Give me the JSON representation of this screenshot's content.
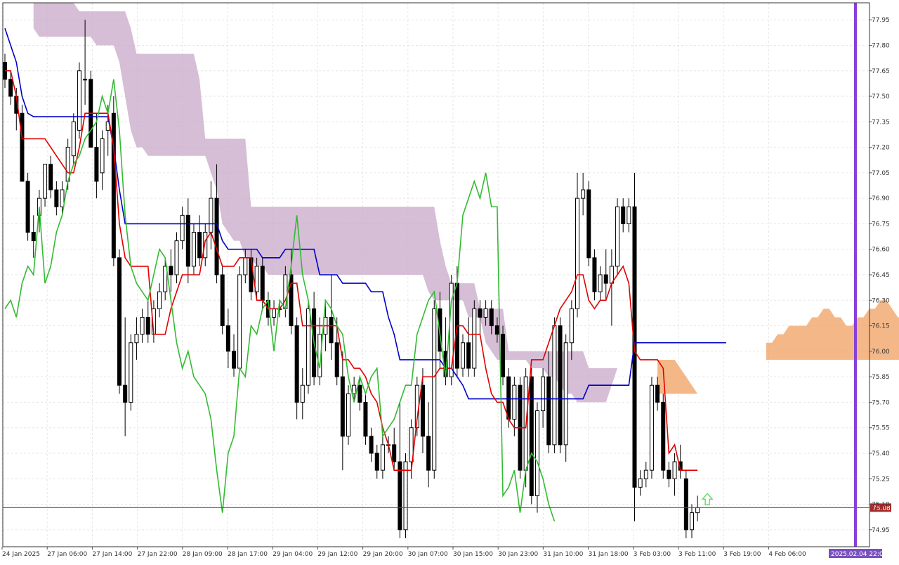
{
  "chart_data": {
    "type": "candlestick",
    "indicator": "Ichimoku Kinko Hyo",
    "ylim": [
      74.85,
      78.05
    ],
    "y_ticks": [
      "77.95",
      "77.80",
      "77.65",
      "77.50",
      "77.35",
      "77.20",
      "77.05",
      "76.90",
      "76.75",
      "76.60",
      "76.45",
      "76.30",
      "76.15",
      "76.00",
      "75.85",
      "75.70",
      "75.55",
      "75.40",
      "75.25",
      "75.10",
      "74.95"
    ],
    "x_ticks": [
      "24 Jan 2025",
      "27 Jan 06:00",
      "27 Jan 14:00",
      "27 Jan 22:00",
      "28 Jan 09:00",
      "28 Jan 17:00",
      "29 Jan 04:00",
      "29 Jan 12:00",
      "29 Jan 20:00",
      "30 Jan 07:00",
      "30 Jan 15:00",
      "30 Jan 23:00",
      "31 Jan 10:00",
      "31 Jan 18:00",
      "3 Feb 03:00",
      "3 Feb 11:00",
      "3 Feb 19:00",
      "4 Feb 06:00"
    ],
    "current_price": "75.08",
    "current_time_label": "2025.02.04 22:00",
    "candles": [
      [
        77.7,
        77.75,
        77.55,
        77.6
      ],
      [
        77.6,
        77.65,
        77.45,
        77.5
      ],
      [
        77.5,
        77.55,
        77.3,
        77.4
      ],
      [
        77.4,
        77.45,
        77.0,
        77.0
      ],
      [
        77.0,
        77.05,
        76.65,
        76.7
      ],
      [
        76.7,
        76.8,
        76.55,
        76.65
      ],
      [
        76.8,
        76.95,
        76.7,
        76.9
      ],
      [
        76.9,
        77.1,
        76.85,
        77.1
      ],
      [
        77.1,
        77.15,
        76.9,
        76.95
      ],
      [
        76.95,
        77.0,
        76.8,
        76.85
      ],
      [
        76.85,
        77.0,
        76.8,
        76.95
      ],
      [
        77.0,
        77.25,
        76.95,
        77.2
      ],
      [
        77.15,
        77.4,
        77.1,
        77.35
      ],
      [
        77.3,
        77.7,
        77.25,
        77.65
      ],
      [
        77.6,
        77.95,
        77.45,
        77.6
      ],
      [
        77.6,
        77.65,
        77.2,
        77.2
      ],
      [
        77.2,
        77.4,
        76.9,
        77.0
      ],
      [
        77.05,
        77.3,
        76.95,
        77.25
      ],
      [
        77.3,
        77.45,
        77.15,
        77.35
      ],
      [
        77.4,
        77.5,
        76.5,
        76.55
      ],
      [
        76.55,
        76.6,
        75.75,
        75.8
      ],
      [
        75.8,
        76.2,
        75.5,
        75.7
      ],
      [
        75.7,
        76.1,
        75.65,
        76.05
      ],
      [
        76.05,
        76.2,
        75.95,
        76.1
      ],
      [
        76.1,
        76.25,
        76.05,
        76.2
      ],
      [
        76.2,
        76.3,
        76.05,
        76.1
      ],
      [
        76.1,
        76.3,
        76.05,
        76.25
      ],
      [
        76.25,
        76.4,
        76.2,
        76.35
      ],
      [
        76.35,
        76.55,
        76.3,
        76.5
      ],
      [
        76.5,
        76.6,
        76.35,
        76.45
      ],
      [
        76.45,
        76.7,
        76.4,
        76.65
      ],
      [
        76.65,
        76.85,
        76.6,
        76.8
      ],
      [
        76.8,
        76.9,
        76.4,
        76.5
      ],
      [
        76.5,
        76.75,
        76.45,
        76.7
      ],
      [
        76.7,
        76.8,
        76.5,
        76.55
      ],
      [
        76.55,
        76.75,
        76.5,
        76.7
      ],
      [
        76.7,
        77.0,
        76.6,
        76.9
      ],
      [
        76.9,
        77.1,
        76.4,
        76.45
      ],
      [
        76.45,
        76.5,
        76.1,
        76.15
      ],
      [
        76.15,
        76.25,
        75.9,
        76.0
      ],
      [
        76.0,
        76.1,
        75.85,
        75.9
      ],
      [
        75.9,
        76.5,
        75.9,
        76.45
      ],
      [
        76.45,
        76.6,
        76.4,
        76.55
      ],
      [
        76.55,
        76.6,
        76.3,
        76.35
      ],
      [
        76.35,
        76.55,
        76.3,
        76.5
      ],
      [
        76.5,
        76.55,
        76.25,
        76.3
      ],
      [
        76.3,
        76.35,
        76.15,
        76.2
      ],
      [
        76.2,
        76.3,
        76.15,
        76.25
      ],
      [
        76.25,
        76.3,
        76.2,
        76.25
      ],
      [
        76.25,
        76.5,
        76.2,
        76.45
      ],
      [
        76.45,
        76.6,
        76.1,
        76.15
      ],
      [
        76.15,
        76.2,
        75.6,
        75.7
      ],
      [
        75.7,
        75.9,
        75.6,
        75.8
      ],
      [
        75.8,
        76.3,
        75.75,
        76.25
      ],
      [
        76.25,
        76.35,
        75.8,
        75.85
      ],
      [
        75.85,
        76.2,
        75.8,
        76.1
      ],
      [
        76.1,
        76.3,
        76.0,
        76.2
      ],
      [
        76.2,
        76.45,
        75.95,
        76.05
      ],
      [
        76.05,
        76.2,
        75.8,
        75.85
      ],
      [
        75.85,
        76.0,
        75.3,
        75.5
      ],
      [
        75.5,
        75.8,
        75.45,
        75.75
      ],
      [
        75.75,
        75.85,
        75.7,
        75.8
      ],
      [
        75.8,
        75.85,
        75.65,
        75.7
      ],
      [
        75.7,
        75.75,
        75.45,
        75.5
      ],
      [
        75.5,
        75.55,
        75.35,
        75.4
      ],
      [
        75.4,
        75.45,
        75.25,
        75.3
      ],
      [
        75.3,
        75.5,
        75.25,
        75.45
      ],
      [
        75.45,
        75.5,
        75.4,
        75.45
      ],
      [
        75.45,
        75.55,
        75.3,
        75.35
      ],
      [
        75.35,
        75.7,
        74.9,
        74.95
      ],
      [
        74.95,
        75.4,
        74.9,
        75.35
      ],
      [
        75.35,
        75.6,
        75.25,
        75.55
      ],
      [
        75.55,
        75.85,
        75.5,
        75.8
      ],
      [
        75.8,
        75.9,
        75.4,
        75.5
      ],
      [
        75.5,
        75.7,
        75.2,
        75.3
      ],
      [
        75.3,
        76.3,
        75.25,
        76.25
      ],
      [
        76.25,
        76.35,
        75.9,
        76.0
      ],
      [
        76.0,
        76.2,
        75.8,
        75.85
      ],
      [
        75.85,
        76.45,
        75.8,
        76.4
      ],
      [
        76.4,
        76.5,
        75.85,
        75.9
      ],
      [
        75.9,
        76.1,
        75.85,
        76.05
      ],
      [
        76.05,
        76.2,
        75.85,
        75.9
      ],
      [
        75.9,
        76.3,
        75.85,
        76.25
      ],
      [
        76.25,
        76.3,
        76.1,
        76.2
      ],
      [
        76.2,
        76.3,
        76.15,
        76.25
      ],
      [
        76.25,
        76.3,
        76.1,
        76.15
      ],
      [
        76.15,
        76.2,
        76.05,
        76.1
      ],
      [
        76.1,
        76.15,
        75.8,
        75.85
      ],
      [
        75.85,
        75.9,
        75.55,
        75.6
      ],
      [
        75.6,
        75.85,
        75.5,
        75.8
      ],
      [
        75.8,
        75.85,
        75.25,
        75.3
      ],
      [
        75.3,
        75.9,
        75.2,
        75.85
      ],
      [
        75.85,
        75.9,
        75.1,
        75.15
      ],
      [
        75.15,
        75.7,
        75.05,
        75.65
      ],
      [
        75.65,
        75.9,
        75.55,
        75.85
      ],
      [
        75.85,
        76.0,
        75.4,
        75.45
      ],
      [
        75.45,
        76.2,
        75.4,
        76.15
      ],
      [
        76.15,
        76.2,
        75.4,
        75.45
      ],
      [
        75.45,
        76.1,
        75.35,
        76.05
      ],
      [
        76.05,
        76.3,
        75.95,
        76.25
      ],
      [
        76.25,
        77.05,
        76.2,
        76.9
      ],
      [
        76.9,
        77.05,
        76.8,
        76.95
      ],
      [
        76.95,
        77.0,
        76.5,
        76.55
      ],
      [
        76.55,
        76.6,
        76.3,
        76.35
      ],
      [
        76.35,
        76.5,
        76.3,
        76.45
      ],
      [
        76.45,
        76.6,
        76.3,
        76.4
      ],
      [
        76.4,
        76.6,
        76.15,
        76.5
      ],
      [
        76.5,
        76.9,
        76.45,
        76.85
      ],
      [
        76.85,
        76.9,
        76.7,
        76.75
      ],
      [
        76.75,
        76.9,
        76.7,
        76.85
      ],
      [
        76.85,
        77.05,
        75.0,
        75.2
      ],
      [
        75.2,
        75.3,
        75.15,
        75.25
      ],
      [
        75.25,
        75.35,
        75.2,
        75.3
      ],
      [
        75.3,
        75.85,
        75.25,
        75.8
      ],
      [
        75.8,
        75.85,
        75.65,
        75.7
      ],
      [
        75.7,
        75.75,
        75.25,
        75.3
      ],
      [
        75.3,
        75.35,
        75.2,
        75.25
      ],
      [
        75.25,
        75.4,
        75.15,
        75.35
      ],
      [
        75.35,
        75.45,
        75.25,
        75.3
      ],
      [
        75.25,
        75.3,
        74.9,
        74.95
      ],
      [
        74.95,
        75.1,
        74.9,
        75.05
      ],
      [
        75.05,
        75.15,
        75.0,
        75.08
      ]
    ],
    "tenkan": [
      77.65,
      77.65,
      77.5,
      77.25,
      77.25,
      77.25,
      77.25,
      77.25,
      77.2,
      77.15,
      77.1,
      77.05,
      77.05,
      77.2,
      77.4,
      77.4,
      77.4,
      77.4,
      77.4,
      77.2,
      76.75,
      76.55,
      76.5,
      76.5,
      76.5,
      76.5,
      76.1,
      76.1,
      76.1,
      76.25,
      76.35,
      76.45,
      76.45,
      76.45,
      76.45,
      76.65,
      76.7,
      76.6,
      76.5,
      76.5,
      76.5,
      76.55,
      76.55,
      76.55,
      76.3,
      76.3,
      76.25,
      76.25,
      76.25,
      76.3,
      76.4,
      76.4,
      76.15,
      76.15,
      76.15,
      76.15,
      76.15,
      76.15,
      76.15,
      75.95,
      75.95,
      75.9,
      75.9,
      75.85,
      75.75,
      75.7,
      75.55,
      75.45,
      75.3,
      75.3,
      75.3,
      75.3,
      75.6,
      75.85,
      75.85,
      75.85,
      75.9,
      75.9,
      75.9,
      76.15,
      76.15,
      76.1,
      76.1,
      76.1,
      75.9,
      75.75,
      75.7,
      75.7,
      75.6,
      75.55,
      75.55,
      75.55,
      75.95,
      75.95,
      75.95,
      76.05,
      76.15,
      76.25,
      76.3,
      76.35,
      76.45,
      76.45,
      76.3,
      76.25,
      76.3,
      76.3,
      76.4,
      76.45,
      76.5,
      76.4,
      76.0,
      75.95,
      75.95,
      75.95,
      75.95,
      75.9,
      75.4,
      75.45,
      75.3,
      75.3,
      75.3,
      75.3
    ],
    "kijun": [
      77.9,
      77.8,
      77.7,
      77.5,
      77.4,
      77.38,
      77.38,
      77.38,
      77.38,
      77.38,
      77.38,
      77.38,
      77.38,
      77.38,
      77.38,
      77.38,
      77.38,
      77.38,
      77.38,
      77.2,
      76.95,
      76.75,
      76.75,
      76.75,
      76.75,
      76.75,
      76.75,
      76.75,
      76.75,
      76.75,
      76.75,
      76.75,
      76.75,
      76.75,
      76.75,
      76.75,
      76.75,
      76.75,
      76.65,
      76.6,
      76.6,
      76.6,
      76.6,
      76.6,
      76.6,
      76.55,
      76.55,
      76.55,
      76.55,
      76.6,
      76.6,
      76.6,
      76.6,
      76.6,
      76.6,
      76.45,
      76.45,
      76.45,
      76.45,
      76.4,
      76.4,
      76.4,
      76.4,
      76.4,
      76.35,
      76.35,
      76.35,
      76.2,
      76.1,
      75.95,
      75.95,
      75.95,
      75.95,
      75.95,
      75.95,
      75.95,
      75.95,
      75.9,
      75.9,
      75.85,
      75.8,
      75.72,
      75.72,
      75.72,
      75.72,
      75.72,
      75.72,
      75.72,
      75.72,
      75.72,
      75.72,
      75.72,
      75.72,
      75.72,
      75.72,
      75.72,
      75.72,
      75.72,
      75.72,
      75.72,
      75.72,
      75.72,
      75.8,
      75.8,
      75.8,
      75.8,
      75.8,
      75.8,
      75.8,
      75.8,
      76.05,
      76.05,
      76.05,
      76.05,
      76.05,
      76.05,
      76.05,
      76.05,
      76.05,
      76.05,
      76.05,
      76.05,
      76.05,
      76.05,
      76.05,
      76.05,
      76.05
    ],
    "chikou": [
      76.25,
      76.3,
      76.2,
      76.4,
      76.5,
      76.45,
      76.85,
      76.4,
      76.5,
      76.7,
      76.8,
      77.0,
      77.1,
      77.15,
      77.25,
      77.3,
      77.35,
      77.5,
      77.4,
      77.6,
      77.3,
      76.8,
      76.5,
      76.4,
      76.35,
      76.3,
      76.45,
      76.6,
      76.55,
      76.3,
      76.05,
      75.9,
      76.0,
      75.85,
      75.8,
      75.75,
      75.6,
      75.3,
      75.05,
      75.4,
      75.5,
      75.9,
      75.85,
      76.15,
      76.1,
      76.25,
      76.3,
      76.0,
      76.3,
      76.25,
      76.5,
      76.8,
      76.45,
      76.3,
      76.05,
      75.9,
      76.3,
      76.25,
      76.15,
      76.1,
      75.85,
      75.7,
      75.85,
      75.75,
      75.85,
      75.9,
      75.5,
      75.55,
      75.6,
      75.7,
      75.8,
      75.8,
      76.1,
      76.2,
      76.3,
      76.35,
      76.1,
      75.85,
      76.3,
      76.4,
      76.8,
      76.9,
      77.0,
      76.9,
      77.05,
      76.85,
      76.85,
      75.15,
      75.2,
      75.3,
      75.05,
      75.3,
      75.4,
      75.35,
      75.25,
      75.1,
      75.0
    ],
    "cloud": {
      "span_a": [
        78.05,
        78.05,
        78.05,
        78.05,
        78.05,
        78.05,
        78.05,
        78.05,
        78.0,
        78.0,
        78.0,
        78.0,
        78.0,
        78.0,
        78.0,
        78.0,
        78.0,
        77.9,
        77.75,
        77.75,
        77.75,
        77.75,
        77.75,
        77.75,
        77.75,
        77.75,
        77.75,
        77.75,
        77.75,
        77.6,
        77.25,
        77.25,
        77.25,
        77.25,
        77.25,
        77.25,
        77.25,
        77.25,
        76.85,
        76.85,
        76.85,
        76.85,
        76.85,
        76.85,
        76.85,
        76.85,
        76.85,
        76.85,
        76.85,
        76.85,
        76.85,
        76.85,
        76.85,
        76.85,
        76.85,
        76.85,
        76.85,
        76.85,
        76.85,
        76.85,
        76.85,
        76.85,
        76.85,
        76.85,
        76.85,
        76.85,
        76.85,
        76.85,
        76.85,
        76.85,
        76.85,
        76.65,
        76.5,
        76.4,
        76.4,
        76.4,
        76.4,
        76.4,
        76.25,
        76.25,
        76.25,
        76.25,
        76.25,
        76.0,
        76.0,
        76.0,
        76.0,
        76.0,
        76.0,
        76.0,
        76.0,
        76.0,
        76.0,
        76.0,
        76.0,
        76.0,
        76.0,
        75.9,
        75.9,
        75.9,
        75.9,
        75.9,
        75.9
      ],
      "span_b": [
        77.9,
        77.85,
        77.85,
        77.85,
        77.85,
        77.85,
        77.85,
        77.85,
        77.85,
        77.85,
        77.85,
        77.8,
        77.8,
        77.8,
        77.8,
        77.7,
        77.5,
        77.3,
        77.2,
        77.2,
        77.15,
        77.15,
        77.15,
        77.15,
        77.15,
        77.15,
        77.15,
        77.15,
        77.15,
        77.15,
        77.15,
        77.05,
        76.95,
        76.75,
        76.7,
        76.65,
        76.65,
        76.55,
        76.55,
        76.5,
        76.5,
        76.45,
        76.45,
        76.45,
        76.45,
        76.45,
        76.45,
        76.45,
        76.45,
        76.45,
        76.45,
        76.45,
        76.45,
        76.45,
        76.45,
        76.45,
        76.45,
        76.45,
        76.45,
        76.45,
        76.45,
        76.45,
        76.45,
        76.45,
        76.45,
        76.45,
        76.45,
        76.45,
        76.45,
        76.35,
        76.3,
        76.3,
        76.3,
        76.3,
        76.3,
        76.3,
        76.2,
        76.2,
        76.2,
        76.05,
        76.0,
        75.95,
        75.95,
        75.95,
        75.95,
        75.95,
        75.95,
        75.9,
        75.9,
        75.9,
        75.85,
        75.85,
        75.8,
        75.75,
        75.75,
        75.7,
        75.7,
        75.7,
        75.7,
        75.7,
        75.7
      ],
      "future_span_a": [
        76.05,
        76.05,
        76.1,
        76.1,
        76.15,
        76.15,
        76.15,
        76.15,
        76.2,
        76.2,
        76.25,
        76.25,
        76.2,
        76.2,
        76.15,
        76.15,
        76.2,
        76.2,
        76.25,
        76.25,
        76.3,
        76.3,
        76.25,
        76.2,
        76.2
      ],
      "future_span_b": [
        75.95,
        75.95,
        75.95,
        75.95,
        75.95,
        75.95,
        75.95,
        75.95,
        75.95,
        75.95,
        75.95,
        75.95,
        75.95,
        75.95,
        75.95,
        75.95,
        75.95,
        75.95,
        75.95,
        75.95,
        75.95,
        75.95,
        75.95,
        75.95,
        75.95
      ]
    },
    "colors": {
      "bull_candle": "#ffffff",
      "bear_candle": "#000000",
      "tenkan": "#e00000",
      "kijun": "#0000c8",
      "chikou": "#33bb33",
      "cloud_bearish": "#c8a8c8",
      "cloud_bullish": "#f0a060",
      "current_price_line": "#a52a2a",
      "time_marker": "#8a3fd9",
      "signal_arrow": "#66dd66",
      "grid": "#e6e6e6",
      "time_label_bg": "#7a4fc0"
    }
  }
}
